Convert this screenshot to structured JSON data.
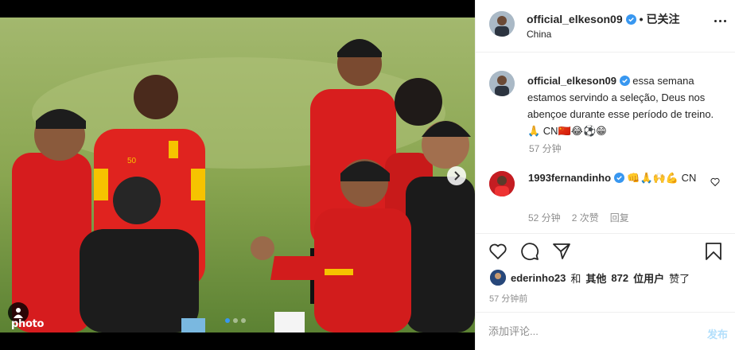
{
  "media": {
    "watermark": "photo",
    "watermark_icon": "iphoto-logo",
    "carousel": {
      "dot_count": 3,
      "active_index": 0
    },
    "next_icon": "chevron-right-icon",
    "user_tag_icon": "person-icon",
    "accent": "#3897f0"
  },
  "header": {
    "username": "official_elkeson09",
    "separator": "•",
    "follow_status": "已关注",
    "location": "China"
  },
  "caption": {
    "username": "official_elkeson09",
    "text": "essa semana estamos servindo a seleção, Deus nos abençoe durante esse período de treino. 🙏 CN🇨🇳😂⚽️😁",
    "time": "57 分钟"
  },
  "comments": [
    {
      "username": "1993fernandinho",
      "text": "👊🙏🙌💪 CN",
      "time": "52 分钟",
      "likes": "2 次赞",
      "reply": "回复"
    }
  ],
  "actions": {
    "likes_user": "ederinho23",
    "likes_conj": "和",
    "likes_others_label": "其他",
    "likes_count": "872",
    "likes_suffix": "位用户",
    "likes_verb": "赞了",
    "post_time": "57 分钟前"
  },
  "comment_box": {
    "placeholder": "添加评论...",
    "post_label": "发布"
  },
  "colors": {
    "verified_blue": "#3897f0",
    "post_button_disabled": "#b2dffc",
    "secondary_text": "#8e8e8e"
  }
}
